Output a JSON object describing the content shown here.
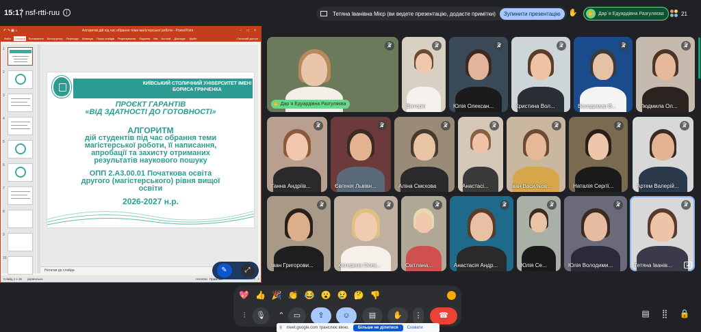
{
  "topbar": {
    "time": "15:17",
    "meeting_code": "nsf-rtti-ruu",
    "presenting_text": "Тетяна Іванівна Мієр (ви ведете презентацію, додасте примітки)",
    "stop_presenting_label": "Зупинити презентацію",
    "raised_hand_name": "Дар`я Едуардівна Разгуляєва",
    "participants_count": "21"
  },
  "ppt": {
    "window_title": "Алгоритмі дій під час обрання теми магістерської роботи - PowerPoint",
    "ribbon_tabs": [
      "Файл",
      "Основне",
      "Вставлення",
      "Конструктор",
      "Переходи",
      "Анімація",
      "Показ слайдів",
      "Рецензування",
      "Подання",
      "Mix",
      "Acrobat",
      "Докладні",
      "Удобн"
    ],
    "share_label": "Спільний доступ",
    "thumbnail_numbers": [
      "1",
      "2",
      "3",
      "4",
      "5",
      "6",
      "7",
      "8",
      "9",
      "10"
    ],
    "notes_label": "Нотатки до слайда",
    "status_left": "Слайд 1 з 16",
    "status_lang": "українська",
    "status_notes": "Нотатки",
    "status_comments": "Примітки",
    "slide": {
      "university": "КИЇВСЬКИЙ СТОЛИЧНИЙ УНІВЕРСИТЕТ ІМЕНІ БОРИСА ГРІНЧЕНКА",
      "project_line1": "ПРОЄКТ ГАРАНТІВ",
      "project_line2": "«ВІД ЗДАТНОСТІ ДО ГОТОВНОСТІ»",
      "algo": "АЛГОРИТМ",
      "line1": "дій студентів під час обрання теми",
      "line2": "магістерської роботи, її написання,",
      "line3": "апробації та захисту отриманих",
      "line4": "результатів наукового пошуку",
      "opp1": "ОПП 2.А3.00.01 Початкова освіта",
      "opp2": "другого (магістерського) рівня вищої",
      "opp3": "освіти",
      "year": "2026-2027 н.р."
    }
  },
  "participants": [
    {
      "name": "Дар`я Едуардівна Разгуляєва"
    },
    {
      "name": "Вікторія"
    },
    {
      "name": "Юлія Олексан..."
    },
    {
      "name": "Кристина Вол..."
    },
    {
      "name": "Володимир В..."
    },
    {
      "name": "Людмила Ол..."
    },
    {
      "name": "Ганна Андріїв..."
    },
    {
      "name": "Євгенія Львівн..."
    },
    {
      "name": "Аліна Смєхова"
    },
    {
      "name": "Анастасі..."
    },
    {
      "name": "Іван Васильов..."
    },
    {
      "name": "Наталія Сергії..."
    },
    {
      "name": "Артем Валерій..."
    },
    {
      "name": "Іван Григорови..."
    },
    {
      "name": "Катерина Олек..."
    },
    {
      "name": "Світлана..."
    },
    {
      "name": "Анастасія Андр..."
    },
    {
      "name": "Юлія Се..."
    },
    {
      "name": "Юлія Володими..."
    },
    {
      "name": "Тетяна Іванів..."
    }
  ],
  "reactions": [
    "💖",
    "👍",
    "🎉",
    "👏",
    "😂",
    "😮",
    "😢",
    "🤔",
    "👎"
  ],
  "share_banner": {
    "text": "meet.google.com транслює вікно.",
    "stop_label": "Більше не ділитися",
    "hide_label": "Сховати"
  }
}
